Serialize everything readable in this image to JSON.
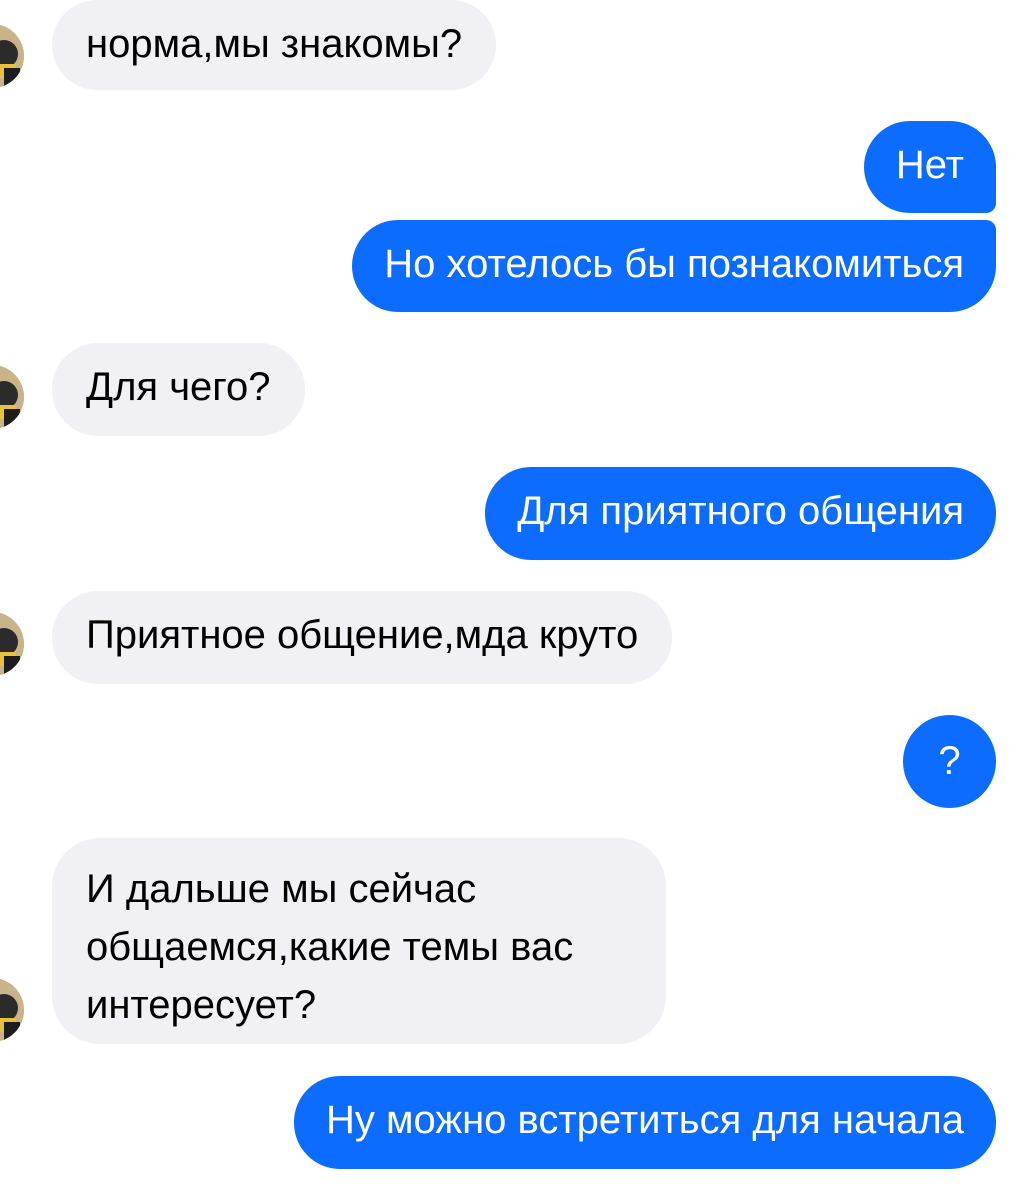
{
  "colors": {
    "incoming_bubble": "#f0f0f5",
    "outgoing_bubble": "#0b6cff",
    "incoming_text": "#000000",
    "outgoing_text": "#ffffff"
  },
  "messages": [
    {
      "direction": "incoming",
      "text": "норма,мы знакомы?"
    },
    {
      "direction": "outgoing",
      "text": "Нет"
    },
    {
      "direction": "outgoing",
      "text": "Но хотелось бы познакомиться"
    },
    {
      "direction": "incoming",
      "text": "Для чего?"
    },
    {
      "direction": "outgoing",
      "text": "Для приятного общения"
    },
    {
      "direction": "incoming",
      "text": "Приятное общение,мда круто"
    },
    {
      "direction": "outgoing",
      "text": "?"
    },
    {
      "direction": "incoming",
      "text": "И дальше  мы сейчас общаемся,какие темы вас интересует?"
    },
    {
      "direction": "outgoing",
      "text": "Ну можно встретиться для начала"
    }
  ]
}
